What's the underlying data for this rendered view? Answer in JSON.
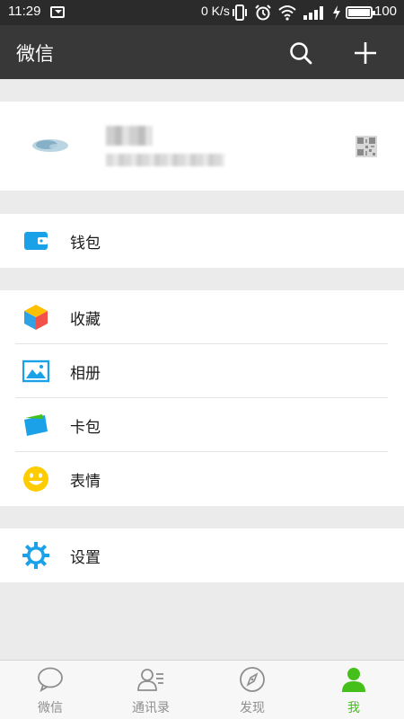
{
  "status_bar": {
    "time": "11:29",
    "net_speed": "0 K/s",
    "battery": "100",
    "icons": [
      "message-icon",
      "vibrate-icon",
      "alarm-icon",
      "wifi-icon",
      "signal-icon",
      "charging-icon",
      "battery-icon"
    ]
  },
  "header": {
    "title": "微信",
    "icons": [
      "search-icon",
      "plus-icon"
    ]
  },
  "profile": {
    "icons": [
      "avatar",
      "qr-code-icon"
    ]
  },
  "menu": {
    "wallet": {
      "label": "钱包",
      "icon": "wallet-icon"
    },
    "favorites": {
      "label": "收藏",
      "icon": "cube-icon"
    },
    "album": {
      "label": "相册",
      "icon": "image-icon"
    },
    "cards": {
      "label": "卡包",
      "icon": "card-icon"
    },
    "stickers": {
      "label": "表情",
      "icon": "smiley-icon"
    },
    "settings": {
      "label": "设置",
      "icon": "gear-icon"
    }
  },
  "tabs": [
    {
      "label": "微信",
      "icon": "chat-bubble-icon",
      "active": false
    },
    {
      "label": "通讯录",
      "icon": "contacts-icon",
      "active": false
    },
    {
      "label": "发现",
      "icon": "compass-icon",
      "active": false
    },
    {
      "label": "我",
      "icon": "person-icon",
      "active": true
    }
  ],
  "colors": {
    "status_bar": "#2b2b2b",
    "title_bar": "#383838",
    "background": "#ebebeb",
    "active_tab": "#45c01a",
    "inactive_tab": "#8e8e8e",
    "accent_blue": "#1aa1e8",
    "sticker_yellow": "#ffcc00"
  }
}
